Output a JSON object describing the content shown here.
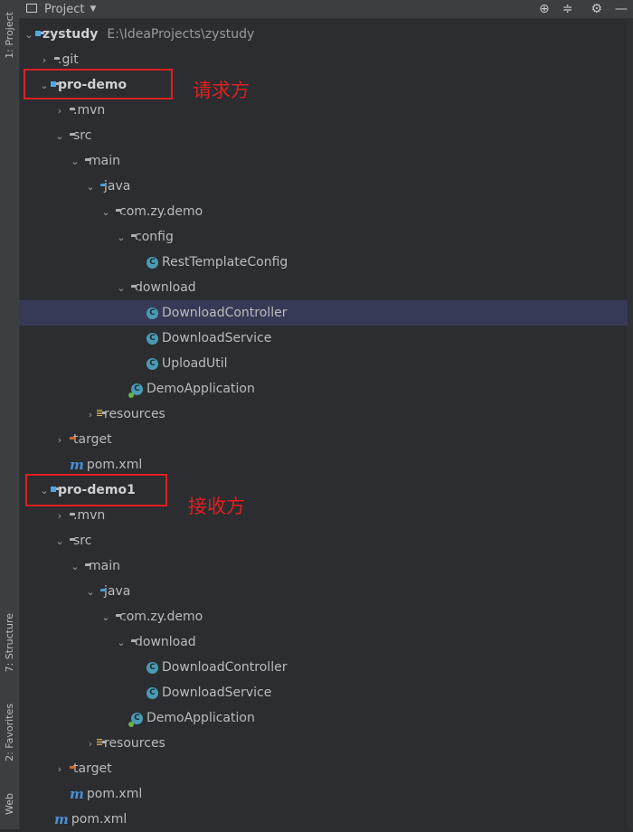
{
  "header": {
    "title": "Project"
  },
  "sidebar": {
    "project_tab": "1: Project",
    "structure_tab": "7: Structure",
    "favorites_tab": "2: Favorites",
    "web_tab": "Web"
  },
  "annotations": {
    "requester": "请求方",
    "receiver": "接收方"
  },
  "tree": {
    "root": {
      "name": "zystudy",
      "path": "E:\\IdeaProjects\\zystudy"
    },
    "git": ".git",
    "pro_demo": {
      "name": "pro-demo",
      "mvn": ".mvn",
      "src": "src",
      "main": "main",
      "java": "java",
      "pkg": "com.zy.demo",
      "config": "config",
      "rest_template_config": "RestTemplateConfig",
      "download": "download",
      "download_controller": "DownloadController",
      "download_service": "DownloadService",
      "upload_util": "UploadUtil",
      "demo_application": "DemoApplication",
      "resources": "resources",
      "target": "target",
      "pom": "pom.xml"
    },
    "pro_demo1": {
      "name": "pro-demo1",
      "mvn": ".mvn",
      "src": "src",
      "main": "main",
      "java": "java",
      "pkg": "com.zy.demo",
      "download": "download",
      "download_controller": "DownloadController",
      "download_service": "DownloadService",
      "demo_application": "DemoApplication",
      "resources": "resources",
      "target": "target",
      "pom": "pom.xml"
    },
    "root_pom": "pom.xml"
  }
}
